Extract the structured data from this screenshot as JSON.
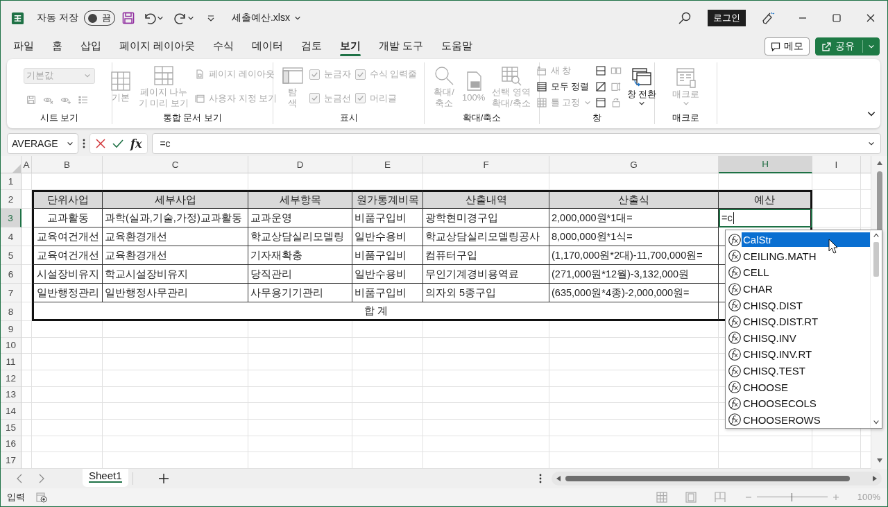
{
  "title_bar": {
    "autosave_label": "자동 저장",
    "autosave_toggle": {
      "label": "끔",
      "on": false
    },
    "file_name": "세출예산.xlsx",
    "login_button": "로그인"
  },
  "menu_tabs": [
    {
      "label": "파일",
      "selected": false
    },
    {
      "label": "홈",
      "selected": false
    },
    {
      "label": "삽입",
      "selected": false
    },
    {
      "label": "페이지 레이아웃",
      "selected": false
    },
    {
      "label": "수식",
      "selected": false
    },
    {
      "label": "데이터",
      "selected": false
    },
    {
      "label": "검토",
      "selected": false
    },
    {
      "label": "보기",
      "selected": true
    },
    {
      "label": "개발 도구",
      "selected": false
    },
    {
      "label": "도움말",
      "selected": false
    }
  ],
  "memo_button": "메모",
  "share_button": "공유",
  "ribbon": {
    "groups": [
      {
        "label": "시트 보기",
        "columns": [
          [
            {
              "kind": "dropdown",
              "label": "기본값",
              "disabled": true
            },
            {
              "kind": "icons",
              "buttons": [
                {
                  "disabled": true
                },
                {
                  "disabled": true
                },
                {
                  "disabled": true
                },
                {
                  "disabled": true
                }
              ]
            }
          ]
        ]
      },
      {
        "label": "통합 문서 보기",
        "columns": [
          [
            {
              "kind": "large",
              "label": "기본",
              "disabled": true
            }
          ],
          [
            {
              "kind": "large",
              "label": "페이지 나누\n기 미리 보기",
              "disabled": true
            }
          ],
          [
            {
              "kind": "small",
              "label": "페이지 레이아웃",
              "disabled": true
            },
            {
              "kind": "small",
              "label": "사용자 지정 보기",
              "disabled": true
            }
          ]
        ]
      },
      {
        "label": "표시",
        "columns": [
          [
            {
              "kind": "large",
              "label": "탐\n색",
              "disabled": true
            }
          ],
          [
            {
              "kind": "checkbox",
              "label": "눈금자",
              "checked": true,
              "disabled": true
            },
            {
              "kind": "checkbox",
              "label": "눈금선",
              "checked": true,
              "disabled": true
            }
          ],
          [
            {
              "kind": "checkbox",
              "label": "수식 입력줄",
              "checked": true,
              "disabled": true
            },
            {
              "kind": "checkbox",
              "label": "머리글",
              "checked": true,
              "disabled": true
            }
          ]
        ]
      },
      {
        "label": "확대/축소",
        "columns": [
          [
            {
              "kind": "large",
              "label": "확대/\n축소",
              "disabled": true
            }
          ],
          [
            {
              "kind": "large",
              "label": "100%",
              "disabled": true
            }
          ],
          [
            {
              "kind": "large",
              "label": "선택 영역\n확대/축소",
              "disabled": true
            }
          ]
        ]
      },
      {
        "label": "창",
        "columns": [
          [
            {
              "kind": "small",
              "label": "새 창",
              "disabled": true
            },
            {
              "kind": "small",
              "label": "모두 정렬",
              "disabled": false
            },
            {
              "kind": "small",
              "label": "틀 고정",
              "disabled": true,
              "has_menu": true
            }
          ],
          [
            {
              "kind": "icon",
              "disabled": false
            },
            {
              "kind": "icon",
              "disabled": false
            },
            {
              "kind": "icon",
              "disabled": false
            }
          ],
          [
            {
              "kind": "icon",
              "disabled": true
            },
            {
              "kind": "icon",
              "disabled": true
            },
            {
              "kind": "icon",
              "disabled": true
            }
          ],
          [
            {
              "kind": "large",
              "label": "창 전환",
              "disabled": false,
              "has_menu": true
            }
          ]
        ]
      },
      {
        "label": "매크로",
        "columns": [
          [
            {
              "kind": "large",
              "label": "매크로",
              "disabled": true,
              "has_menu": true
            }
          ]
        ]
      }
    ]
  },
  "formula_bar": {
    "name_box": "AVERAGE",
    "fx_label": "fx",
    "formula": "=c"
  },
  "sheet": {
    "columns": [
      {
        "label": "A",
        "selected": false
      },
      {
        "label": "B",
        "selected": false
      },
      {
        "label": "C",
        "selected": false
      },
      {
        "label": "D",
        "selected": false
      },
      {
        "label": "E",
        "selected": false
      },
      {
        "label": "F",
        "selected": false
      },
      {
        "label": "G",
        "selected": false
      },
      {
        "label": "H",
        "selected": true
      },
      {
        "label": "I",
        "selected": false
      }
    ],
    "rows": [
      {
        "label": "1",
        "selected": false
      },
      {
        "label": "2",
        "selected": false
      },
      {
        "label": "3",
        "selected": true
      },
      {
        "label": "4",
        "selected": false
      },
      {
        "label": "5",
        "selected": false
      },
      {
        "label": "6",
        "selected": false
      },
      {
        "label": "7",
        "selected": false
      },
      {
        "label": "8",
        "selected": false
      },
      {
        "label": "9",
        "selected": false
      },
      {
        "label": "10",
        "selected": false
      },
      {
        "label": "11",
        "selected": false
      },
      {
        "label": "12",
        "selected": false
      },
      {
        "label": "13",
        "selected": false
      },
      {
        "label": "14",
        "selected": false
      },
      {
        "label": "15",
        "selected": false
      },
      {
        "label": "16",
        "selected": false
      },
      {
        "label": "17",
        "selected": false
      }
    ],
    "table": {
      "header": [
        "단위사업",
        "세부사업",
        "세부항목",
        "원가통계비목",
        "산출내역",
        "산출식",
        "예산"
      ],
      "rows": [
        {
          "cells": [
            "교과활동",
            "과학(실과,기술,가정)교과활동",
            "교과운영",
            "비품구입비",
            "광학현미경구입",
            "2,000,000원*1대="
          ],
          "active_cell": {
            "value": "=c"
          }
        },
        {
          "cells": [
            "교육여건개선",
            "교육환경개선",
            "학교상담실리모델링",
            "일반수용비",
            "학교상담실리모델링공사",
            "8,000,000원*1식="
          ]
        },
        {
          "cells": [
            "교육여건개선",
            "교육환경개선",
            "기자재확충",
            "비품구입비",
            "컴퓨터구입",
            "(1,170,000원*2대)-11,700,000원="
          ]
        },
        {
          "cells": [
            "시설장비유지",
            "학교시설장비유지",
            "당직관리",
            "일반수용비",
            "무인기계경비용역료",
            "(271,000원*12월)-3,132,000원"
          ]
        },
        {
          "cells": [
            "일반행정관리",
            "일반행정사무관리",
            "사무용기기관리",
            "비품구입비",
            "의자외 5종구입",
            "(635,000원*4종)-2,000,000원="
          ]
        }
      ],
      "total_label": "합 계"
    }
  },
  "autocomplete": {
    "items": [
      {
        "label": "CalStr",
        "selected": true
      },
      {
        "label": "CEILING.MATH",
        "selected": false
      },
      {
        "label": "CELL",
        "selected": false
      },
      {
        "label": "CHAR",
        "selected": false
      },
      {
        "label": "CHISQ.DIST",
        "selected": false
      },
      {
        "label": "CHISQ.DIST.RT",
        "selected": false
      },
      {
        "label": "CHISQ.INV",
        "selected": false
      },
      {
        "label": "CHISQ.INV.RT",
        "selected": false
      },
      {
        "label": "CHISQ.TEST",
        "selected": false
      },
      {
        "label": "CHOOSE",
        "selected": false
      },
      {
        "label": "CHOOSECOLS",
        "selected": false
      },
      {
        "label": "CHOOSEROWS",
        "selected": false
      }
    ]
  },
  "sheet_tabs": [
    {
      "label": "Sheet1",
      "selected": true
    }
  ],
  "status_bar": {
    "mode": "입력",
    "zoom": {
      "level": 0.5,
      "label": "100%"
    }
  }
}
